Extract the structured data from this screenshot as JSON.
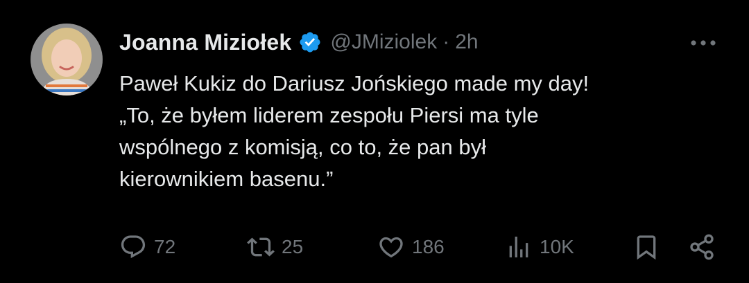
{
  "author": {
    "display_name": "Joanna Miziołek",
    "handle": "@JMiziolek",
    "separator": "·",
    "time": "2h",
    "verified": true
  },
  "tweet": {
    "lines": [
      "Paweł Kukiz do Dariusz Jońskiego made my day!",
      "„To, że byłem liderem zespołu Piersi ma tyle",
      "wspólnego z komisją, co to, że pan był",
      "kierownikiem basenu.”"
    ]
  },
  "actions": {
    "replies": "72",
    "retweets": "25",
    "likes": "186",
    "views": "10K"
  },
  "colors": {
    "background": "#000000",
    "primary_text": "#e7e9ea",
    "secondary_text": "#71767b",
    "verified_badge": "#1d9bf0"
  }
}
